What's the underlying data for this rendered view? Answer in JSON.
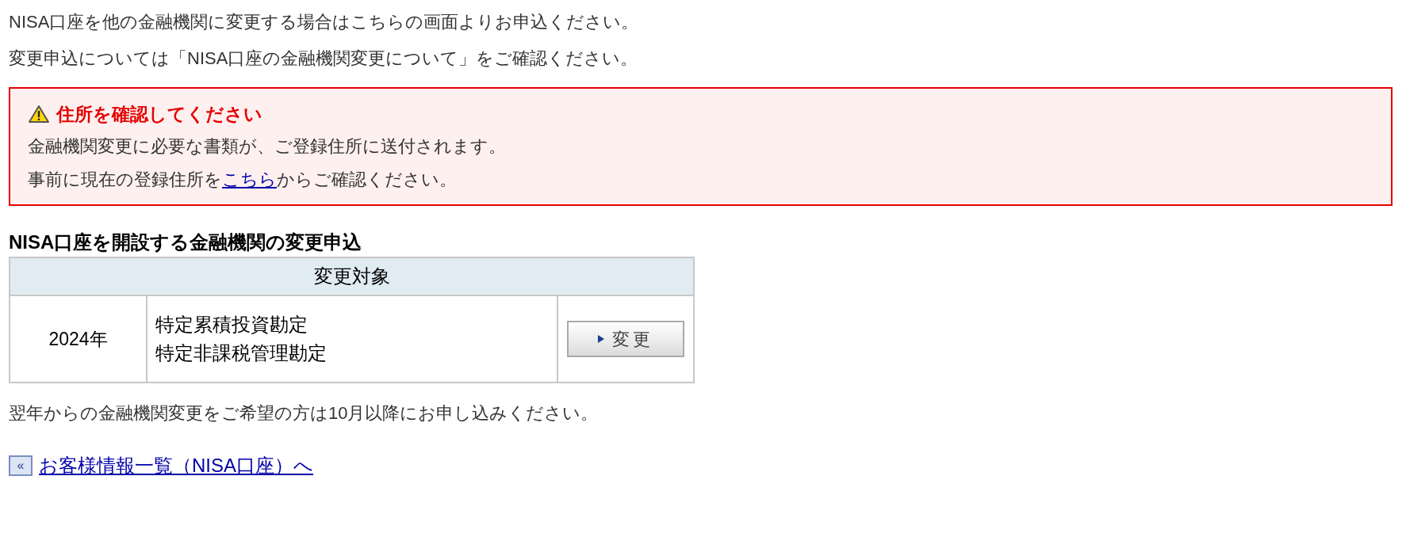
{
  "intro": [
    "NISA口座を他の金融機関に変更する場合はこちらの画面よりお申込ください。",
    "変更申込については「NISA口座の金融機関変更について」をご確認ください。"
  ],
  "warning": {
    "title": "住所を確認してください",
    "lines": [
      {
        "before": "金融機関変更に必要な書類が、ご登録住所に送付されます。"
      },
      {
        "before": "事前に現在の登録住所を",
        "link": "こちら",
        "after": "からご確認ください。"
      }
    ]
  },
  "section_title": "NISA口座を開設する金融機関の変更申込",
  "table": {
    "header": "変更対象",
    "rows": [
      {
        "year": "2024年",
        "accounts": [
          "特定累積投資勘定",
          "特定非課税管理勘定"
        ],
        "button": "変更"
      }
    ]
  },
  "note": "翌年からの金融機関変更をご希望の方は10月以降にお申し込みください。",
  "back_link": {
    "icon": "«",
    "label": "お客様情報一覧（NISA口座）へ"
  }
}
